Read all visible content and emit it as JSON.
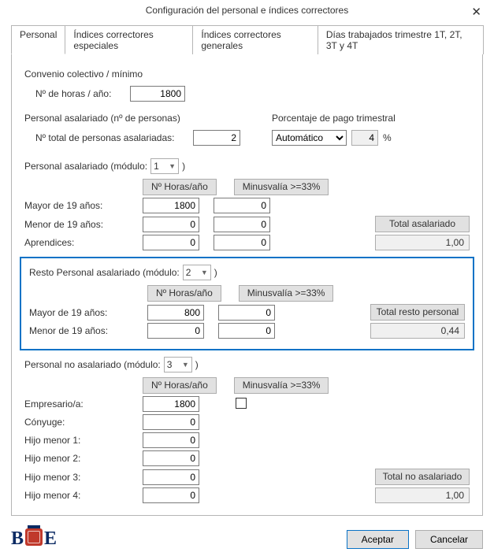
{
  "title": "Configuración del personal e índices correctores",
  "tabs": {
    "personal": "Personal",
    "ic_especiales": "Índices correctores especiales",
    "ic_generales": "Índices correctores generales",
    "dias": "Días trabajados trimestre 1T, 2T, 3T y 4T"
  },
  "convenio": {
    "section": "Convenio colectivo / mínimo",
    "horas_label": "Nº de horas / año:",
    "horas_value": "1800"
  },
  "asalariado_personas": {
    "section": "Personal asalariado (nº de personas)",
    "total_label": "Nº total de personas asalariadas:",
    "total_value": "2",
    "pago_section": "Porcentaje de pago trimestral",
    "pago_options": [
      "Automático"
    ],
    "pago_selected": "Automático",
    "pago_pct": "4",
    "pct_sign": "%"
  },
  "columns": {
    "horas": "Nº Horas/año",
    "minus": "Minusvalía >=33%"
  },
  "mod1": {
    "section_prefix": "Personal asalariado (módulo:",
    "section_suffix": ")",
    "module_value": "1",
    "rows": {
      "mayor19": {
        "label": "Mayor de 19 años:",
        "horas": "1800",
        "minus": "0"
      },
      "menor19": {
        "label": "Menor de 19 años:",
        "horas": "0",
        "minus": "0"
      },
      "aprendices": {
        "label": "Aprendices:",
        "horas": "0",
        "minus": "0"
      }
    },
    "total_label": "Total asalariado",
    "total_value": "1,00"
  },
  "mod2": {
    "section_prefix": "Resto Personal asalariado (módulo:",
    "section_suffix": ")",
    "module_value": "2",
    "rows": {
      "mayor19": {
        "label": "Mayor de 19 años:",
        "horas": "800",
        "minus": "0"
      },
      "menor19": {
        "label": "Menor de 19 años:",
        "horas": "0",
        "minus": "0"
      }
    },
    "total_label": "Total resto personal",
    "total_value": "0,44"
  },
  "mod3": {
    "section_prefix": "Personal no asalariado (módulo:",
    "section_suffix": ")",
    "module_value": "3",
    "rows": {
      "empresario": {
        "label": "Empresario/a:",
        "horas": "1800",
        "minus_checked": false
      },
      "conyuge": {
        "label": "Cónyuge:",
        "horas": "0"
      },
      "hijo1": {
        "label": "Hijo menor 1:",
        "horas": "0"
      },
      "hijo2": {
        "label": "Hijo menor 2:",
        "horas": "0"
      },
      "hijo3": {
        "label": "Hijo menor 3:",
        "horas": "0"
      },
      "hijo4": {
        "label": "Hijo menor 4:",
        "horas": "0"
      }
    },
    "total_label": "Total no asalariado",
    "total_value": "1,00"
  },
  "footer": {
    "logo_b1": "B",
    "logo_b2": "E",
    "accept": "Aceptar",
    "cancel": "Cancelar"
  }
}
